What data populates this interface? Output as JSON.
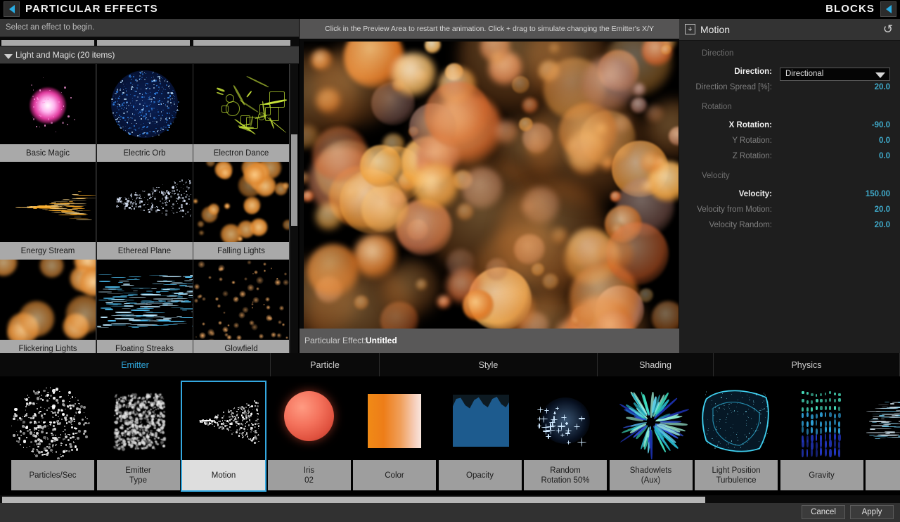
{
  "topbar": {
    "back_icon": "chevron-left-icon",
    "title": "PARTICULAR EFFECTS",
    "blocks_label": "BLOCKS",
    "blocks_icon": "chevron-left-icon"
  },
  "left_panel": {
    "hint": "Select an effect to begin.",
    "group": {
      "label": "Light and Magic (20 items)",
      "expanded_icon": "triangle-down-icon"
    },
    "presets": [
      {
        "label": "Basic Magic",
        "art": "magic-burst"
      },
      {
        "label": "Electric Orb",
        "art": "electric-orb"
      },
      {
        "label": "Electron Dance",
        "art": "electron-dance"
      },
      {
        "label": "Energy Stream",
        "art": "energy-stream"
      },
      {
        "label": "Ethereal Plane",
        "art": "ethereal-plane"
      },
      {
        "label": "Falling Lights",
        "art": "falling-lights"
      },
      {
        "label": "Flickering Lights",
        "art": "flickering-lights"
      },
      {
        "label": "Floating Streaks",
        "art": "floating-streaks"
      },
      {
        "label": "Glowfield",
        "art": "glowfield"
      }
    ]
  },
  "preview": {
    "hint": "Click in the Preview Area to restart the animation. Click + drag to simulate changing the Emitter's X/Y",
    "footer_label": "Particular Effect:",
    "footer_value": "Untitled"
  },
  "params": {
    "header_title": "Motion",
    "header_icon": "block-icon",
    "reset_icon": "reset-icon",
    "sections": [
      {
        "name": "Direction",
        "rows": [
          {
            "label": "Direction:",
            "type": "dropdown",
            "value": "Directional",
            "active": true
          },
          {
            "label": "Direction Spread [%]:",
            "type": "value",
            "value": "20.0",
            "active": false
          }
        ]
      },
      {
        "name": "Rotation",
        "rows": [
          {
            "label": "X Rotation:",
            "type": "value",
            "value": "-90.0",
            "active": true
          },
          {
            "label": "Y Rotation:",
            "type": "value",
            "value": "0.0",
            "active": false
          },
          {
            "label": "Z Rotation:",
            "type": "value",
            "value": "0.0",
            "active": false
          }
        ]
      },
      {
        "name": "Velocity",
        "rows": [
          {
            "label": "Velocity:",
            "type": "value",
            "value": "150.00",
            "active": true
          },
          {
            "label": "Velocity from Motion:",
            "type": "value",
            "value": "20.0",
            "active": false
          },
          {
            "label": "Velocity Random:",
            "type": "value",
            "value": "20.0",
            "active": false
          }
        ]
      }
    ]
  },
  "blocks": {
    "tabs": [
      {
        "label": "Emitter",
        "selected": true
      },
      {
        "label": "Particle",
        "selected": false
      },
      {
        "label": "Style",
        "selected": false
      },
      {
        "label": "Shading",
        "selected": false
      },
      {
        "label": "Physics",
        "selected": false
      }
    ],
    "cards": [
      {
        "line1": "Particles/Sec",
        "line2": "",
        "art": "scatter-white",
        "selected": false
      },
      {
        "line1": "Emitter",
        "line2": "Type",
        "art": "box-cloud",
        "selected": false
      },
      {
        "line1": "Motion",
        "line2": "",
        "art": "cone-jet",
        "selected": true
      },
      {
        "line1": "Iris",
        "line2": "02",
        "art": "sphere-red",
        "selected": false
      },
      {
        "line1": "Color",
        "line2": "",
        "art": "gradient-orange",
        "selected": false
      },
      {
        "line1": "Opacity",
        "line2": "",
        "art": "opacity-graph",
        "selected": false
      },
      {
        "line1": "Random",
        "line2": "Rotation 50%",
        "art": "sparkle-blue",
        "selected": false
      },
      {
        "line1": "Shadowlets",
        "line2": "(Aux)",
        "art": "burst-streaks",
        "selected": false
      },
      {
        "line1": "Light Position",
        "line2": "Turbulence",
        "art": "turbulence-mesh",
        "selected": false
      },
      {
        "line1": "Gravity",
        "line2": "",
        "art": "gravity-fall",
        "selected": false
      },
      {
        "line1": "",
        "line2": "",
        "art": "streaks-edge",
        "selected": false
      }
    ]
  },
  "footer": {
    "cancel_label": "Cancel",
    "apply_label": "Apply"
  },
  "colors": {
    "accent": "#29abe2",
    "value_text": "#3fa9c9",
    "panel_bg": "#1e1e1e",
    "caption_bg": "#9e9e9e"
  }
}
